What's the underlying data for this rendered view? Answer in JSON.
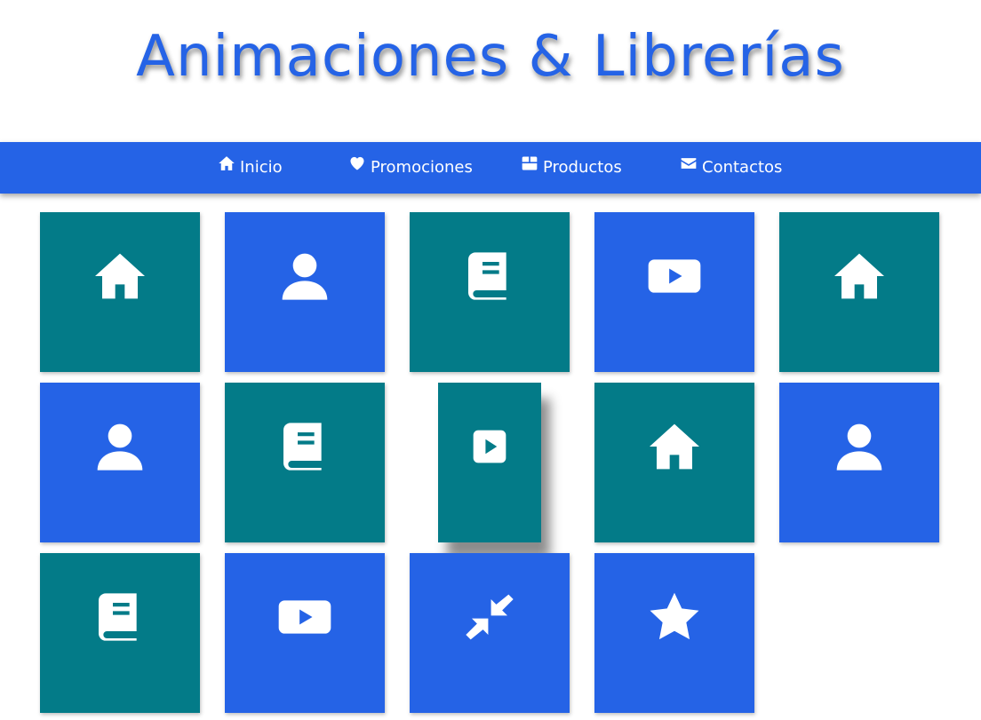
{
  "page": {
    "title": "Animaciones & Librerías"
  },
  "nav": {
    "items": [
      {
        "label": "Inicio",
        "icon": "home-icon"
      },
      {
        "label": "Promociones",
        "icon": "heart-icon"
      },
      {
        "label": "Productos",
        "icon": "box-icon"
      },
      {
        "label": "Contactos",
        "icon": "envelope-icon"
      }
    ]
  },
  "colors": {
    "primary": "#2563e6",
    "teal": "#037b88",
    "text_on_tile": "#ffffff",
    "background": "#ffffff"
  },
  "grid": {
    "tiles": [
      {
        "icon": "home-icon",
        "color": "teal"
      },
      {
        "icon": "user-icon",
        "color": "blue"
      },
      {
        "icon": "book-icon",
        "color": "teal"
      },
      {
        "icon": "youtube-play-icon",
        "color": "blue"
      },
      {
        "icon": "home-icon",
        "color": "teal"
      },
      {
        "icon": "user-icon",
        "color": "blue"
      },
      {
        "icon": "book-icon",
        "color": "teal"
      },
      {
        "icon": "play-square-icon",
        "color": "teal"
      },
      {
        "icon": "home-icon",
        "color": "teal"
      },
      {
        "icon": "user-icon",
        "color": "blue"
      },
      {
        "icon": "book-icon",
        "color": "teal"
      },
      {
        "icon": "youtube-play-icon",
        "color": "blue"
      },
      {
        "icon": "compress-arrows-icon",
        "color": "blue"
      },
      {
        "icon": "star-icon",
        "color": "blue"
      }
    ]
  }
}
